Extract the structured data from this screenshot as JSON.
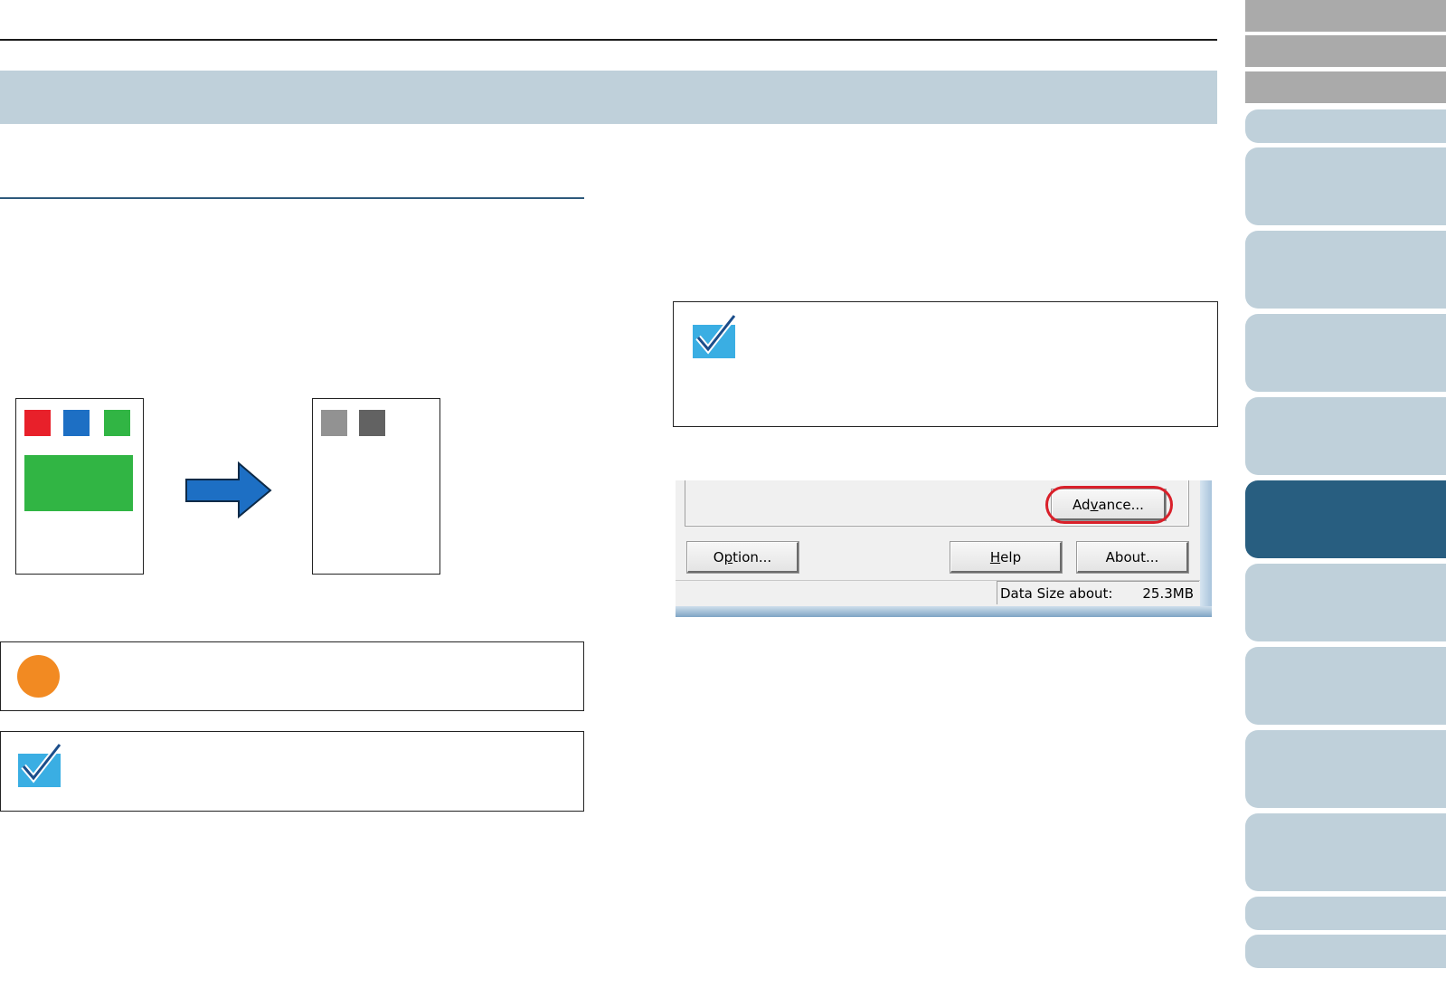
{
  "page": {
    "title": "",
    "section_heading": ""
  },
  "illustration": {
    "source_colors": [
      "#e8202a",
      "#1d6fc4",
      "#31b544"
    ],
    "source_block_color": "#31b544",
    "result_colors": [
      "#929292",
      "#626262"
    ],
    "arrow_color": "#1d6fc4"
  },
  "callouts": {
    "attention_icon_color": "#f28a22",
    "hint_icon_color": "#3aaee3"
  },
  "dialog": {
    "advance_button": {
      "label_pre": "Ad",
      "label_u": "v",
      "label_post": "ance..."
    },
    "option_button": {
      "label_pre": "O",
      "label_u": "p",
      "label_post": "tion..."
    },
    "help_button": {
      "label_pre": "",
      "label_u": "H",
      "label_post": "elp"
    },
    "about_button": {
      "label": "About..."
    },
    "status": {
      "data_size_label": "Data Size about:",
      "data_size_value": "25.3MB"
    },
    "highlight_color": "#d9202a"
  },
  "nav": {
    "active_color": "#285e80",
    "tab_color": "#bfd0da",
    "top_tab_color": "#aaaaaa"
  }
}
